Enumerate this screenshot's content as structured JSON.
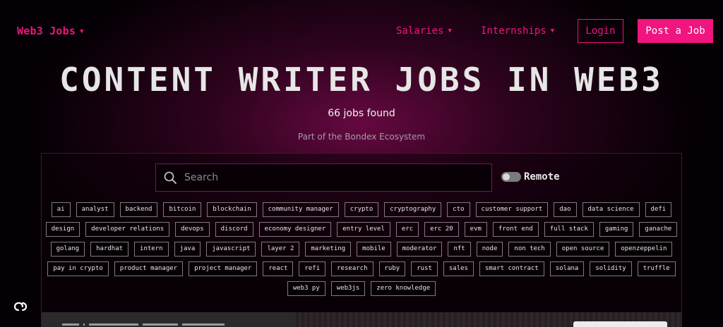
{
  "nav": {
    "brand": "Web3 Jobs",
    "links": [
      "Salaries",
      "Internships"
    ],
    "login": "Login",
    "post_job": "Post a Job"
  },
  "hero": {
    "title": "CONTENT WRITER JOBS IN WEB3",
    "jobs_found": "66 jobs found",
    "ecosystem": "Part of the Bondex Ecosystem"
  },
  "search": {
    "placeholder": "Search",
    "value": "",
    "remote_label": "Remote",
    "remote_enabled": false
  },
  "tags": [
    "ai",
    "analyst",
    "backend",
    "bitcoin",
    "blockchain",
    "community manager",
    "crypto",
    "cryptography",
    "cto",
    "customer support",
    "dao",
    "data science",
    "defi",
    "design",
    "developer relations",
    "devops",
    "discord",
    "economy designer",
    "entry level",
    "erc",
    "erc 20",
    "evm",
    "front end",
    "full stack",
    "gaming",
    "ganache",
    "golang",
    "hardhat",
    "intern",
    "java",
    "javascript",
    "layer 2",
    "marketing",
    "mobile",
    "moderator",
    "nft",
    "node",
    "non tech",
    "open source",
    "openzeppelin",
    "pay in crypto",
    "product manager",
    "project manager",
    "react",
    "refi",
    "research",
    "ruby",
    "rust",
    "sales",
    "smart contract",
    "solana",
    "solidity",
    "truffle",
    "web3 py",
    "web3js",
    "zero knowledge"
  ],
  "icons": {
    "search": "search-icon",
    "chat": "chat-icon",
    "caret": "chevron-down-icon"
  },
  "colors": {
    "accent": "#f0157f",
    "background": "#050005",
    "glow": "#760a4b"
  }
}
